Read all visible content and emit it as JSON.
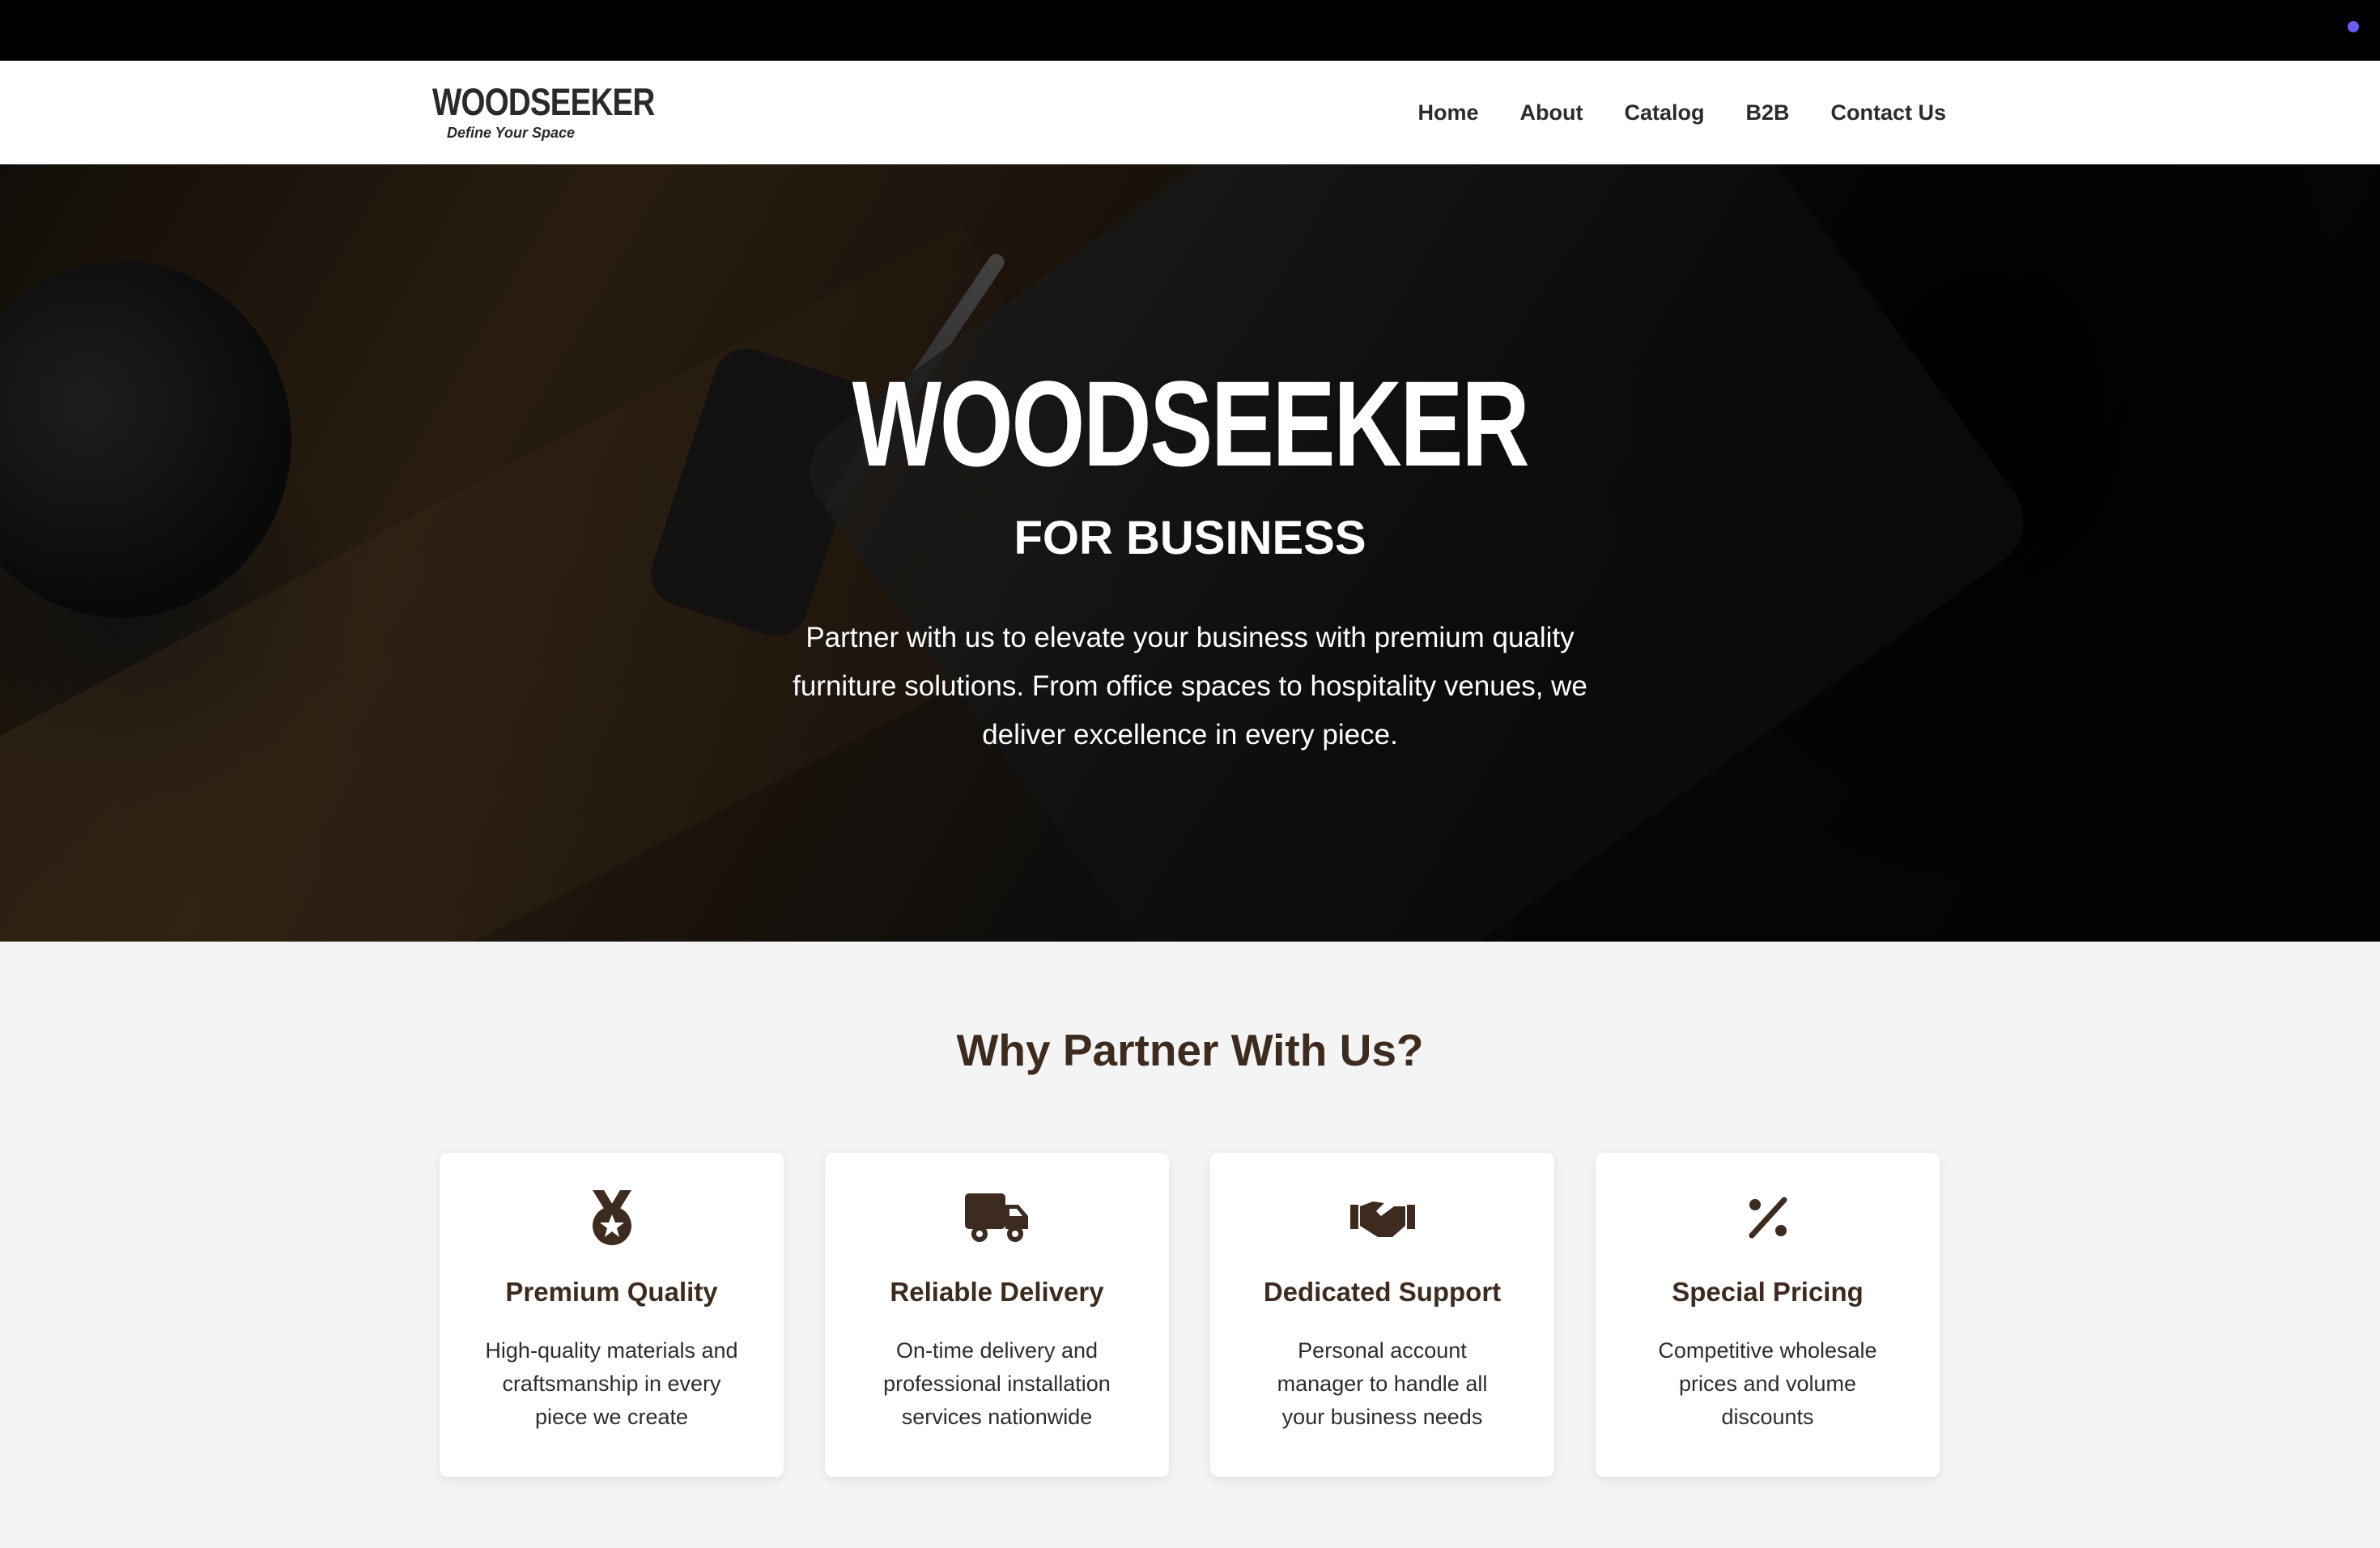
{
  "brand": {
    "name": "WOODSEEKER",
    "tagline": "Define Your Space"
  },
  "nav": {
    "items": [
      "Home",
      "About",
      "Catalog",
      "B2B",
      "Contact Us"
    ]
  },
  "hero": {
    "title": "WOODSEEKER",
    "subtitle": "FOR BUSINESS",
    "description": "Partner with us to elevate your business with premium quality furniture solutions. From office spaces to hospitality venues, we deliver excellence in every piece."
  },
  "why": {
    "title": "Why Partner With Us?",
    "cards": [
      {
        "icon": "medal-icon",
        "title": "Premium Quality",
        "text": "High-quality materials and craftsmanship in every piece we create"
      },
      {
        "icon": "truck-icon",
        "title": "Reliable Delivery",
        "text": "On-time delivery and professional installation services nationwide"
      },
      {
        "icon": "handshake-icon",
        "title": "Dedicated Support",
        "text": "Personal account manager to handle all your business needs"
      },
      {
        "icon": "percent-icon",
        "title": "Special Pricing",
        "text": "Competitive wholesale prices and volume discounts"
      }
    ]
  },
  "colors": {
    "accent": "#3d2b1f",
    "topbar": "#000000",
    "indicator": "#6b5cf6"
  }
}
